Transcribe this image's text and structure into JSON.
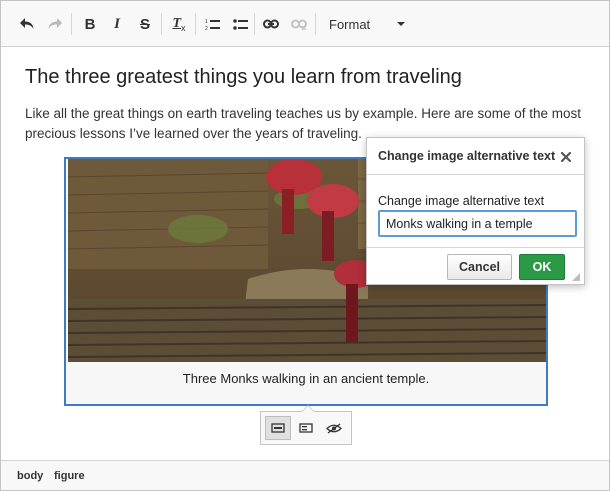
{
  "toolbar": {
    "buttons": [
      {
        "name": "undo-icon"
      },
      {
        "name": "redo-icon"
      },
      {
        "name": "bold-icon",
        "label": "B"
      },
      {
        "name": "italic-icon",
        "label": "I"
      },
      {
        "name": "strike-icon",
        "label": "S"
      },
      {
        "name": "remove-format-icon",
        "label": "T"
      },
      {
        "name": "numbered-list-icon"
      },
      {
        "name": "bulleted-list-icon"
      },
      {
        "name": "link-icon"
      },
      {
        "name": "unlink-icon"
      }
    ],
    "format_label": "Format"
  },
  "content": {
    "heading": "The three greatest things you learn from traveling",
    "paragraph": "Like all the great things on earth traveling teaches us by example. Here are some of the most precious lessons I’ve learned over the years of traveling.",
    "figure": {
      "caption": "Three Monks walking in an ancient temple."
    }
  },
  "image_toolbar": {
    "buttons": [
      "full-width-image-icon",
      "side-image-icon",
      "alt-text-icon"
    ]
  },
  "statusbar": {
    "path": [
      "body",
      "figure"
    ]
  },
  "dialog": {
    "title": "Change image alternative text",
    "field_label": "Change image alternative text",
    "field_value": "Monks walking in a temple",
    "cancel_label": "Cancel",
    "ok_label": "OK"
  },
  "colors": {
    "accent_blue": "#3b7cc4",
    "ok_green": "#2a9a46"
  }
}
